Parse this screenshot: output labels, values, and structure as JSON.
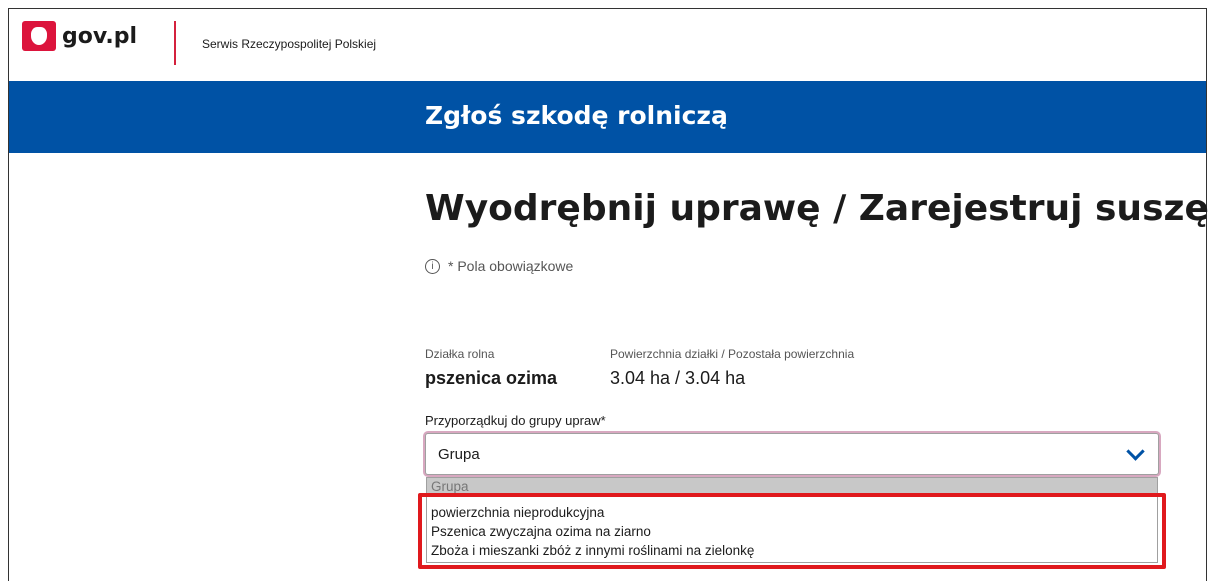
{
  "header": {
    "logo_text": "gov.pl",
    "service_name": "Serwis Rzeczypospolitej Polskiej"
  },
  "banner": {
    "title": "Zgłoś szkodę rolniczą"
  },
  "main": {
    "title": "Wyodrębnij uprawę / Zarejestruj suszę",
    "required_note": "* Pola obowiązkowe",
    "info_icon_glyph": "i",
    "parcel": {
      "label": "Działka rolna",
      "value": "pszenica ozima"
    },
    "area": {
      "label": "Powierzchnia działki / Pozostała powierzchnia",
      "value": "3.04 ha / 3.04 ha"
    },
    "group_select": {
      "label": "Przyporządkuj do grupy upraw*",
      "value": "Grupa",
      "options": [
        "Grupa",
        "powierzchnia nieprodukcyjna",
        "Pszenica zwyczajna ozima na ziarno",
        "Zboża i mieszanki zbóż z innymi roślinami na zielonkę"
      ]
    }
  },
  "colors": {
    "banner": "#0052a5",
    "accent_red": "#d4213d",
    "highlight": "#e0191d"
  }
}
